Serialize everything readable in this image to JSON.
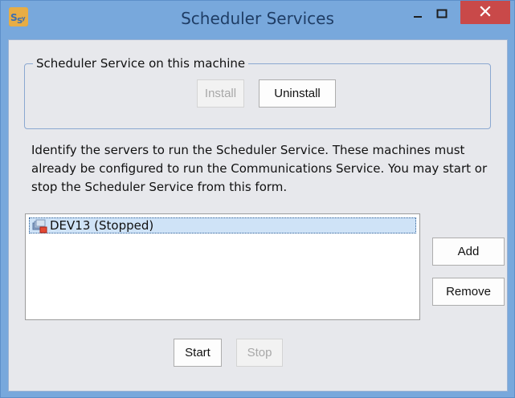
{
  "window": {
    "title": "Scheduler Services",
    "icon": "scheduler-app-icon",
    "controls": {
      "minimize_icon": "minimize-icon",
      "maximize_icon": "maximize-icon",
      "close_icon": "close-icon"
    },
    "colors": {
      "titlebar": "#78a8dc",
      "close_button": "#c94949",
      "client_background": "#e7e8ec"
    }
  },
  "service_group": {
    "label": "Scheduler Service on this machine",
    "install_label": "Install",
    "uninstall_label": "Uninstall"
  },
  "description": "Identify the servers to run the Scheduler Service. These machines must already be configured to run the Communications Service. You may start or stop the Scheduler Service from this form.",
  "servers": [
    {
      "label": "DEV13 (Stopped)",
      "icon": "server-stopped-icon"
    }
  ],
  "buttons": {
    "add": "Add",
    "remove": "Remove",
    "start": "Start",
    "stop": "Stop"
  }
}
